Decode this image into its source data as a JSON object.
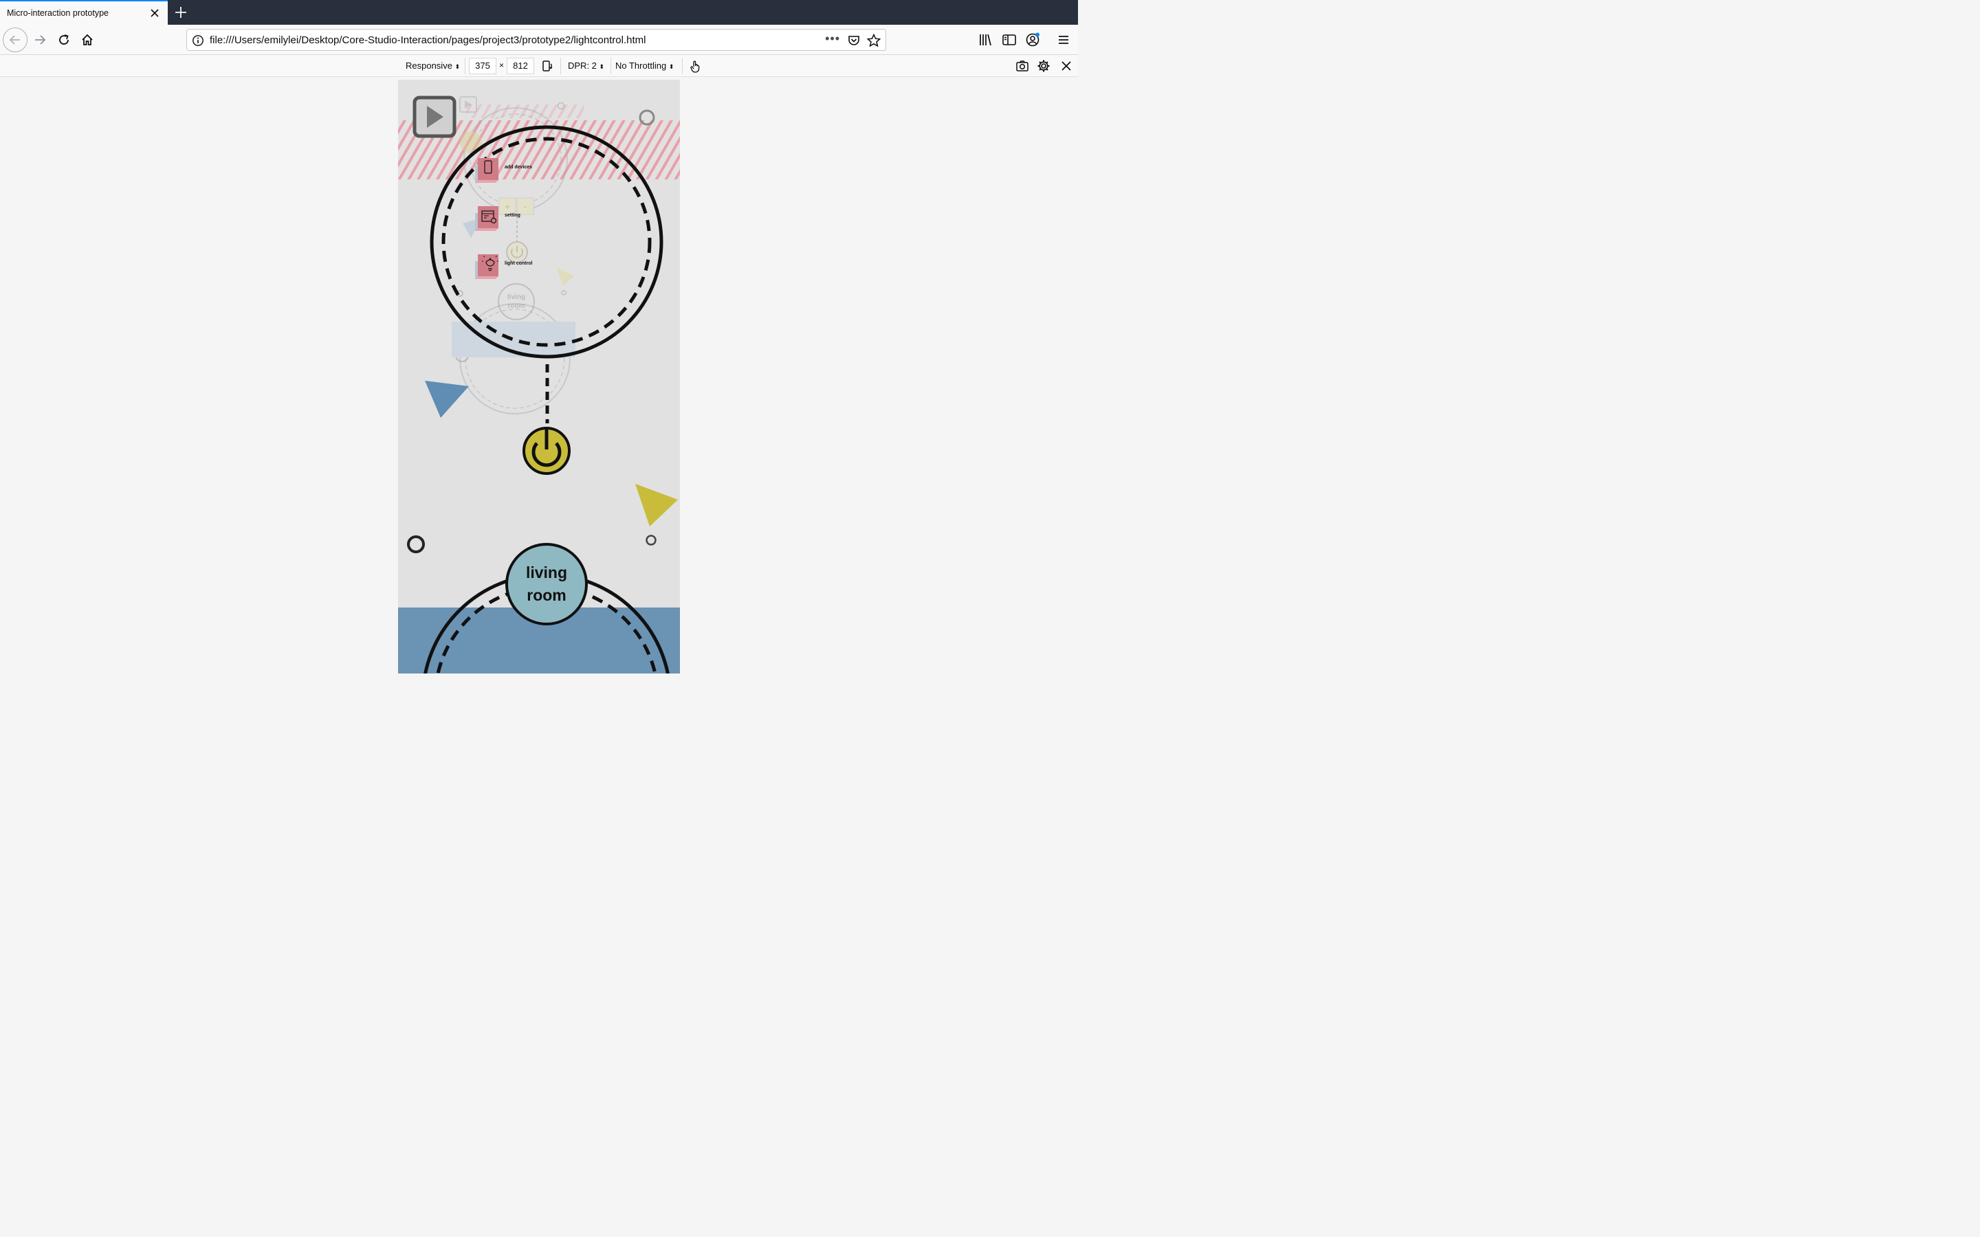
{
  "browser": {
    "tab_title": "Micro-interaction prototype",
    "url": "file:///Users/emilylei/Desktop/Core-Studio-Interaction/pages/project3/prototype2/lightcontrol.html",
    "url_dots": "•••"
  },
  "rdm": {
    "device": "Responsive",
    "width": "375",
    "times": "×",
    "height": "812",
    "dpr": "DPR: 2",
    "throttling": "No Throttling"
  },
  "app": {
    "menu": [
      {
        "label": "add devices",
        "icon": "phone-icon"
      },
      {
        "label": "setting",
        "icon": "gear-panel-icon"
      },
      {
        "label": "light control",
        "icon": "bulb-icon"
      }
    ],
    "ghost_plus": "+",
    "ghost_minus": "-",
    "ghost_room_line1": "living",
    "ghost_room_line2": "room",
    "room_line1": "living",
    "room_line2": "room",
    "colors": {
      "stripe": "#e8a0a8",
      "menu_tile": "#d07c86",
      "power": "#c9bc3a",
      "blue_triangle": "#5f8db3",
      "yellow_triangle": "#c9bc3a",
      "room_circle": "#8fb9c2",
      "bottom_panel": "#6b93b4"
    }
  }
}
